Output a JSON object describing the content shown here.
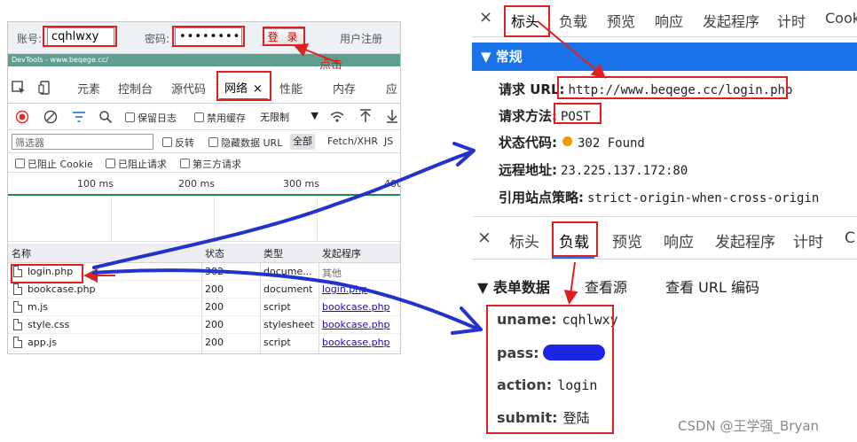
{
  "login": {
    "account_label": "账号:",
    "account_value": "cqhlwxy",
    "password_label": "密码:",
    "password_value": "••••••••",
    "login_button": "登 录",
    "register_link": "用户注册",
    "devtools_title": "DevTools - www.beqege.cc/"
  },
  "annotations": {
    "click_note": "点击"
  },
  "devtools": {
    "tabs": [
      "元素",
      "控制台",
      "源代码",
      "网络",
      "性能",
      "内存",
      "应"
    ],
    "active_tab_close": "×",
    "toolbar": {
      "preserve_log": "保留日志",
      "disable_cache": "禁用缓存",
      "throttle": "无限制"
    },
    "filter": {
      "placeholder": "筛选器",
      "invert": "反转",
      "hide_data_url": "隐藏数据 URL",
      "all": "全部",
      "fetch_xhr": "Fetch/XHR",
      "js": "JS"
    },
    "blocked": {
      "blocked_cookie": "已阻止 Cookie",
      "blocked_requests": "已阻止请求",
      "third_party": "第三方请求"
    },
    "timeline_ticks": [
      "100 ms",
      "200 ms",
      "300 ms",
      "400"
    ],
    "table": {
      "headers": [
        "名称",
        "状态",
        "类型",
        "发起程序"
      ],
      "rows": [
        {
          "name": "login.php",
          "status": "302",
          "type": "docume...",
          "initiator": "其他"
        },
        {
          "name": "bookcase.php",
          "status": "200",
          "type": "document",
          "initiator": "login.php"
        },
        {
          "name": "m.js",
          "status": "200",
          "type": "script",
          "initiator": "bookcase.php"
        },
        {
          "name": "style.css",
          "status": "200",
          "type": "stylesheet",
          "initiator": "bookcase.php"
        },
        {
          "name": "app.js",
          "status": "200",
          "type": "script",
          "initiator": "bookcase.php"
        }
      ]
    }
  },
  "headers_panel": {
    "close": "×",
    "tabs": [
      "标头",
      "负载",
      "预览",
      "响应",
      "发起程序",
      "计时",
      "Cook"
    ],
    "section": "▼ 常规",
    "request_url_label": "请求 URL:",
    "request_url": "http://www.beqege.cc/login.php",
    "method_label": "请求方法:",
    "method": "POST",
    "status_label": "状态代码:",
    "status": "302 Found",
    "remote_label": "远程地址:",
    "remote": "23.225.137.172:80",
    "referrer_label": "引用站点策略:",
    "referrer": "strict-origin-when-cross-origin"
  },
  "payload_panel": {
    "close": "×",
    "tabs": [
      "标头",
      "负载",
      "预览",
      "响应",
      "发起程序",
      "计时",
      "C"
    ],
    "form_data": "▼ 表单数据",
    "view_source": "查看源",
    "view_url_encoded": "查看 URL 编码",
    "fields": [
      {
        "key": "uname:",
        "value": "cqhlwxy"
      },
      {
        "key": "pass:",
        "value": ""
      },
      {
        "key": "action:",
        "value": "login"
      },
      {
        "key": "submit:",
        "value": "登陆"
      }
    ]
  },
  "watermark": "CSDN @王学强_Bryan",
  "colors": {
    "accent": "#1a73e8",
    "annotation_red": "#e02020",
    "arrow_blue": "#2233cc"
  }
}
